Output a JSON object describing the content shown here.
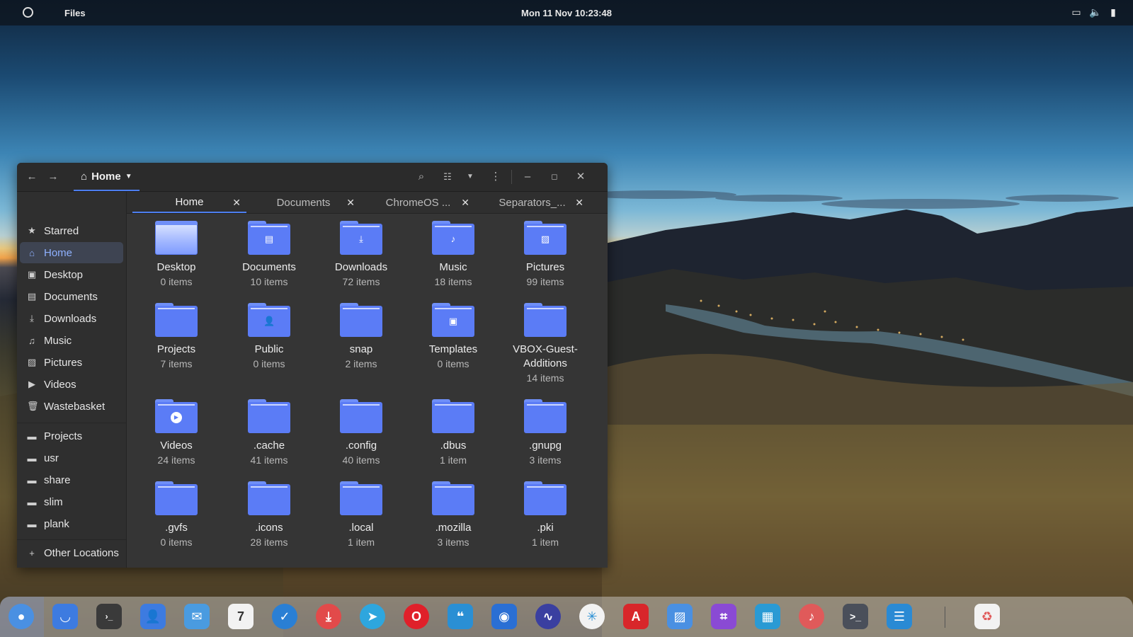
{
  "topbar": {
    "app_name": "Files",
    "clock": "Mon 11 Nov  10:23:48"
  },
  "window": {
    "path_label": "Home",
    "sidebar": {
      "places": [
        {
          "label": "Starred",
          "icon": "star-icon"
        },
        {
          "label": "Home",
          "icon": "home-icon",
          "active": true
        },
        {
          "label": "Desktop",
          "icon": "desktop-icon"
        },
        {
          "label": "Documents",
          "icon": "document-icon"
        },
        {
          "label": "Downloads",
          "icon": "download-icon"
        },
        {
          "label": "Music",
          "icon": "music-icon"
        },
        {
          "label": "Pictures",
          "icon": "picture-icon"
        },
        {
          "label": "Videos",
          "icon": "video-icon"
        },
        {
          "label": "Wastebasket",
          "icon": "trash-icon"
        }
      ],
      "bookmarks": [
        {
          "label": "Projects",
          "icon": "folder-icon"
        },
        {
          "label": "usr",
          "icon": "folder-icon"
        },
        {
          "label": "share",
          "icon": "folder-icon"
        },
        {
          "label": "slim",
          "icon": "folder-icon"
        },
        {
          "label": "plank",
          "icon": "folder-icon"
        }
      ],
      "other_locations": "Other Locations"
    },
    "tabs": [
      {
        "label": "Home",
        "active": true
      },
      {
        "label": "Documents"
      },
      {
        "label": "ChromeOS ..."
      },
      {
        "label": "Separators_..."
      }
    ],
    "items": [
      {
        "name": "Desktop",
        "count": "0 items",
        "icon": "desktop-folder-icon"
      },
      {
        "name": "Documents",
        "count": "10 items",
        "icon": "documents-folder-icon"
      },
      {
        "name": "Downloads",
        "count": "72 items",
        "icon": "downloads-folder-icon"
      },
      {
        "name": "Music",
        "count": "18 items",
        "icon": "music-folder-icon"
      },
      {
        "name": "Pictures",
        "count": "99 items",
        "icon": "pictures-folder-icon"
      },
      {
        "name": "Projects",
        "count": "7 items",
        "icon": "folder-icon"
      },
      {
        "name": "Public",
        "count": "0 items",
        "icon": "public-folder-icon"
      },
      {
        "name": "snap",
        "count": "2 items",
        "icon": "folder-icon"
      },
      {
        "name": "Templates",
        "count": "0 items",
        "icon": "templates-folder-icon"
      },
      {
        "name": "VBOX-Guest-Additions",
        "count": "14 items",
        "icon": "folder-icon"
      },
      {
        "name": "Videos",
        "count": "24 items",
        "icon": "videos-folder-icon"
      },
      {
        "name": ".cache",
        "count": "41 items",
        "icon": "folder-icon"
      },
      {
        "name": ".config",
        "count": "40 items",
        "icon": "folder-icon"
      },
      {
        "name": ".dbus",
        "count": "1 item",
        "icon": "folder-icon"
      },
      {
        "name": ".gnupg",
        "count": "3 items",
        "icon": "folder-icon"
      },
      {
        "name": ".gvfs",
        "count": "0 items",
        "icon": "folder-icon"
      },
      {
        "name": ".icons",
        "count": "28 items",
        "icon": "folder-icon"
      },
      {
        "name": ".local",
        "count": "1 item",
        "icon": "folder-icon"
      },
      {
        "name": ".mozilla",
        "count": "3 items",
        "icon": "folder-icon"
      },
      {
        "name": ".pki",
        "count": "1 item",
        "icon": "folder-icon"
      }
    ]
  },
  "dock": {
    "apps": [
      {
        "name": "files-icon",
        "color": "#4a90e2"
      },
      {
        "name": "store-icon",
        "color": "#3d7be0"
      },
      {
        "name": "terminal-split-icon",
        "color": "#3a3a3a"
      },
      {
        "name": "contacts-icon",
        "color": "#3d7be0"
      },
      {
        "name": "mail-icon",
        "color": "#4a9be0"
      },
      {
        "name": "calendar-icon",
        "color": "#f2f2f2",
        "text": "7"
      },
      {
        "name": "tasks-icon",
        "color": "#2a7fd4"
      },
      {
        "name": "download-manager-icon",
        "color": "#e24a4a"
      },
      {
        "name": "telegram-icon",
        "color": "#2ea6de"
      },
      {
        "name": "opera-icon",
        "color": "#e0202a"
      },
      {
        "name": "notes-icon",
        "color": "#2a8fd4"
      },
      {
        "name": "disk-icon",
        "color": "#2a6fd4"
      },
      {
        "name": "system-monitor-icon",
        "color": "#3a3fa0"
      },
      {
        "name": "coral-icon",
        "color": "#f2f2f2"
      },
      {
        "name": "pdf-icon",
        "color": "#d8262a"
      },
      {
        "name": "image-viewer-icon",
        "color": "#4a90e2"
      },
      {
        "name": "crop-icon",
        "color": "#8a4ad4"
      },
      {
        "name": "video-editor-icon",
        "color": "#2a9ad4"
      },
      {
        "name": "music-player-icon",
        "color": "#e05a5a"
      },
      {
        "name": "terminal-icon",
        "color": "#4a4f5a"
      },
      {
        "name": "settings-icon",
        "color": "#2a8ad4"
      },
      {
        "name": "trash-icon",
        "color": "#f2f2f2"
      }
    ]
  },
  "colors": {
    "accent": "#4d7ef0",
    "folder": "#5b7cf6",
    "window_bg": "#353535"
  }
}
